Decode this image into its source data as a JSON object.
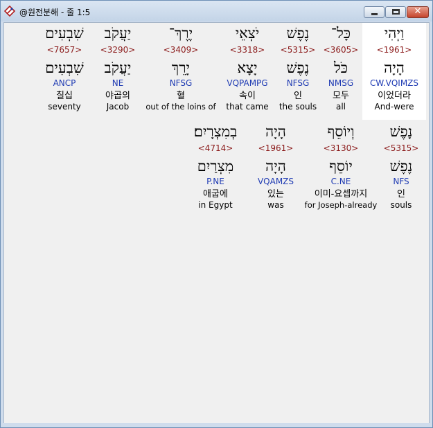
{
  "window": {
    "title": "@원전분해 - 줄 1:5",
    "close_glyph": "✕"
  },
  "lines": [
    {
      "words": [
        {
          "surface": "וַיְהִי",
          "strong": "<1961>",
          "lemma": "הָיָה",
          "code": "CW.VQIMZS",
          "korean": "이었더라",
          "english": "And-were",
          "highlighted": true
        },
        {
          "surface": "כָּל־",
          "strong": "<3605>",
          "lemma": "כֹּל",
          "code": "NMSG",
          "korean": "모두",
          "english": "all"
        },
        {
          "surface": "נֶפֶשׁ",
          "strong": "<5315>",
          "lemma": "נֶפֶשׁ",
          "code": "NFSG",
          "korean": "인",
          "english": "the souls"
        },
        {
          "surface": "יֹצְאֵי",
          "strong": "<3318>",
          "lemma": "יָצָא",
          "code": "VQPAMPG",
          "korean": "속이",
          "english": "that came"
        },
        {
          "surface": "יֶרֶךְ־",
          "strong": "<3409>",
          "lemma": "יָרֵךְ",
          "code": "NFSG",
          "korean": "혈",
          "english": "out of the loins of"
        },
        {
          "surface": "יַעֲקֹב",
          "strong": "<3290>",
          "lemma": "יַעֲקֹב",
          "code": "NE",
          "korean": "야곱의",
          "english": "Jacob"
        },
        {
          "surface": "שִׁבְעִים",
          "strong": "<7657>",
          "lemma": "שִׁבְעִים",
          "code": "ANCP",
          "korean": "칠십",
          "english": "seventy"
        }
      ]
    },
    {
      "words": [
        {
          "surface": "נָפֶשׁ",
          "strong": "<5315>",
          "lemma": "נֶפֶשׁ",
          "code": "NFS",
          "korean": "인",
          "english": "souls"
        },
        {
          "surface": "וְיוֹסֵף",
          "strong": "<3130>",
          "lemma": "יוֹסֵף",
          "code": "C.NE",
          "korean": "이미-요셉까지",
          "english": "for Joseph-already"
        },
        {
          "surface": "הָיָה",
          "strong": "<1961>",
          "lemma": "הָיָה",
          "code": "VQAMZS",
          "korean": "있는",
          "english": "was"
        },
        {
          "surface": "בְמִצְרָיִם׃",
          "strong": "<4714>",
          "lemma": "מִצְרַיִם",
          "code": "P.NE",
          "korean": "애굽에",
          "english": "in Egypt"
        }
      ]
    }
  ]
}
